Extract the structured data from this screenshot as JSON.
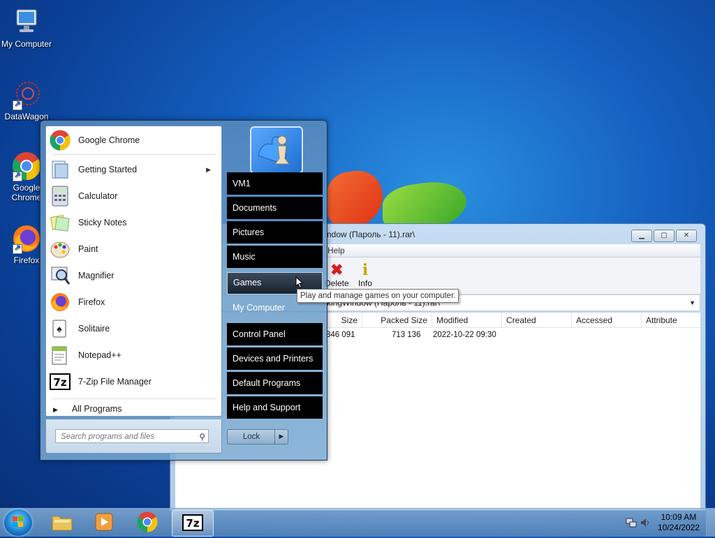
{
  "desktop": {
    "icons": [
      {
        "label": "My Computer"
      },
      {
        "label": "DataWagon"
      },
      {
        "label": "Google Chrome"
      },
      {
        "label": "Firefox"
      }
    ]
  },
  "start_menu": {
    "programs": [
      {
        "label": "Google Chrome",
        "icon": "chrome-icon"
      },
      {
        "label": "Getting Started",
        "icon": "getting-started-icon",
        "submenu": true
      },
      {
        "label": "Calculator",
        "icon": "calculator-icon"
      },
      {
        "label": "Sticky Notes",
        "icon": "sticky-notes-icon"
      },
      {
        "label": "Paint",
        "icon": "paint-icon"
      },
      {
        "label": "Magnifier",
        "icon": "magnifier-icon"
      },
      {
        "label": "Firefox",
        "icon": "firefox-icon"
      },
      {
        "label": "Solitaire",
        "icon": "solitaire-icon"
      },
      {
        "label": "Notepad++",
        "icon": "notepadpp-icon"
      },
      {
        "label": "7-Zip File Manager",
        "icon": "7zip-icon"
      }
    ],
    "all_programs": "All Programs",
    "search_placeholder": "Search programs and files",
    "right_items": [
      {
        "label": "VM1"
      },
      {
        "label": "Documents"
      },
      {
        "label": "Pictures"
      },
      {
        "label": "Music"
      },
      {
        "label": "Games"
      },
      {
        "label": "My Computer"
      },
      {
        "label": "Control Panel"
      },
      {
        "label": "Devices and Printers"
      },
      {
        "label": "Default Programs"
      },
      {
        "label": "Help and Support"
      }
    ],
    "lock_label": "Lock",
    "tooltip": "Play and manage games on your computer."
  },
  "zip_window": {
    "title": "ndow (Пароль - 11).rar\\",
    "menu_help": "Help",
    "toolbar": {
      "delete": "Delete",
      "info": "Info"
    },
    "address": "kingWindow (Пароль - 11).rar\\",
    "columns": [
      "Size",
      "Packed Size",
      "Modified",
      "Created",
      "Accessed",
      "Attribute"
    ],
    "row": {
      "size": "846 091",
      "packed": "713 136",
      "modified": "2022-10-22 09:30"
    }
  },
  "taskbar": {
    "time": "10:09 AM",
    "date": "10/24/2022"
  },
  "colors": {
    "accent": "#1560c0",
    "menu_dark": "#000000"
  }
}
